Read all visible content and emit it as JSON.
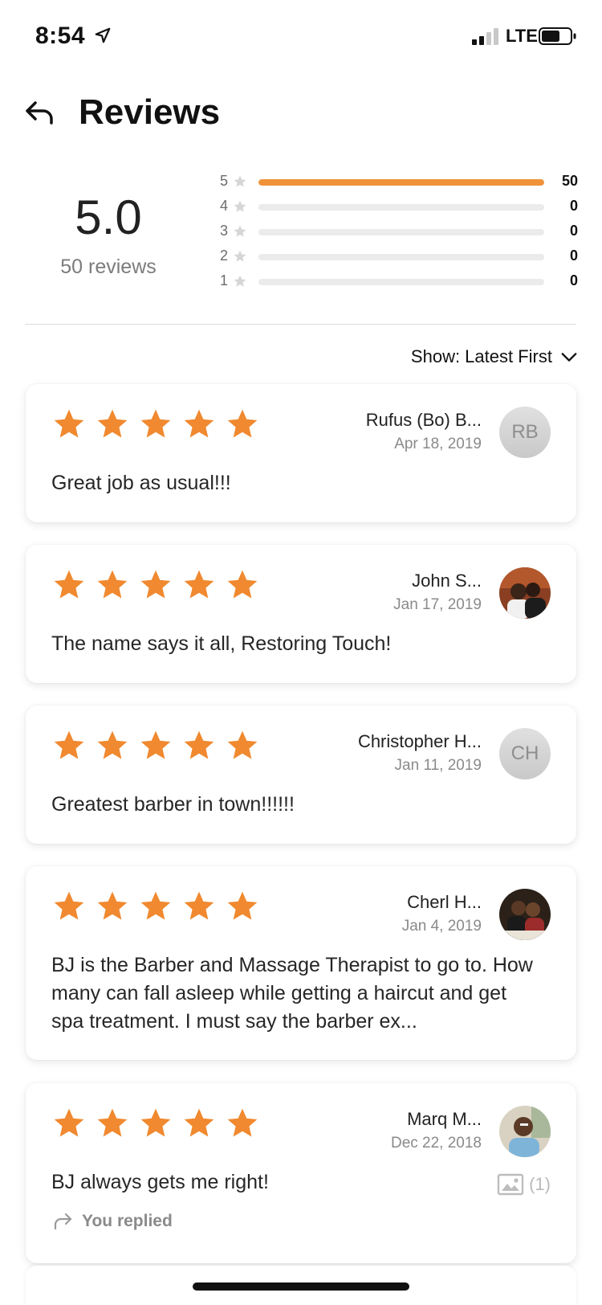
{
  "status_bar": {
    "time": "8:54",
    "network": "LTE"
  },
  "header": {
    "title": "Reviews",
    "back_icon": "back-arrow-icon"
  },
  "summary": {
    "average": "5.0",
    "count_label": "50 reviews",
    "distribution": [
      {
        "stars": "5",
        "count": "50",
        "fraction": 1.0
      },
      {
        "stars": "4",
        "count": "0",
        "fraction": 0
      },
      {
        "stars": "3",
        "count": "0",
        "fraction": 0
      },
      {
        "stars": "2",
        "count": "0",
        "fraction": 0
      },
      {
        "stars": "1",
        "count": "0",
        "fraction": 0
      }
    ]
  },
  "sort": {
    "label": "Show: Latest First"
  },
  "colors": {
    "accent": "#f0923a",
    "star": "#f0892f"
  },
  "reviews": [
    {
      "name": "Rufus (Bo) B...",
      "date": "Apr 18, 2019",
      "rating": 5,
      "avatar_initials": "RB",
      "text": "Great job as usual!!!"
    },
    {
      "name": "John S...",
      "date": "Jan 17, 2019",
      "rating": 5,
      "avatar_initials": "",
      "text": "The name says it all, Restoring Touch!"
    },
    {
      "name": "Christopher H...",
      "date": "Jan 11, 2019",
      "rating": 5,
      "avatar_initials": "CH",
      "text": "Greatest barber in town!!!!!!"
    },
    {
      "name": "Cherl H...",
      "date": "Jan 4, 2019",
      "rating": 5,
      "avatar_initials": "",
      "text": "BJ is the Barber and Massage Therapist to go to. How many can fall asleep while getting a haircut and get spa treatment. I must say the barber ex..."
    },
    {
      "name": "Marq M...",
      "date": "Dec 22, 2018",
      "rating": 5,
      "avatar_initials": "",
      "text": "BJ always gets me right!",
      "photo_count": "(1)",
      "reply_label": "You replied"
    }
  ]
}
